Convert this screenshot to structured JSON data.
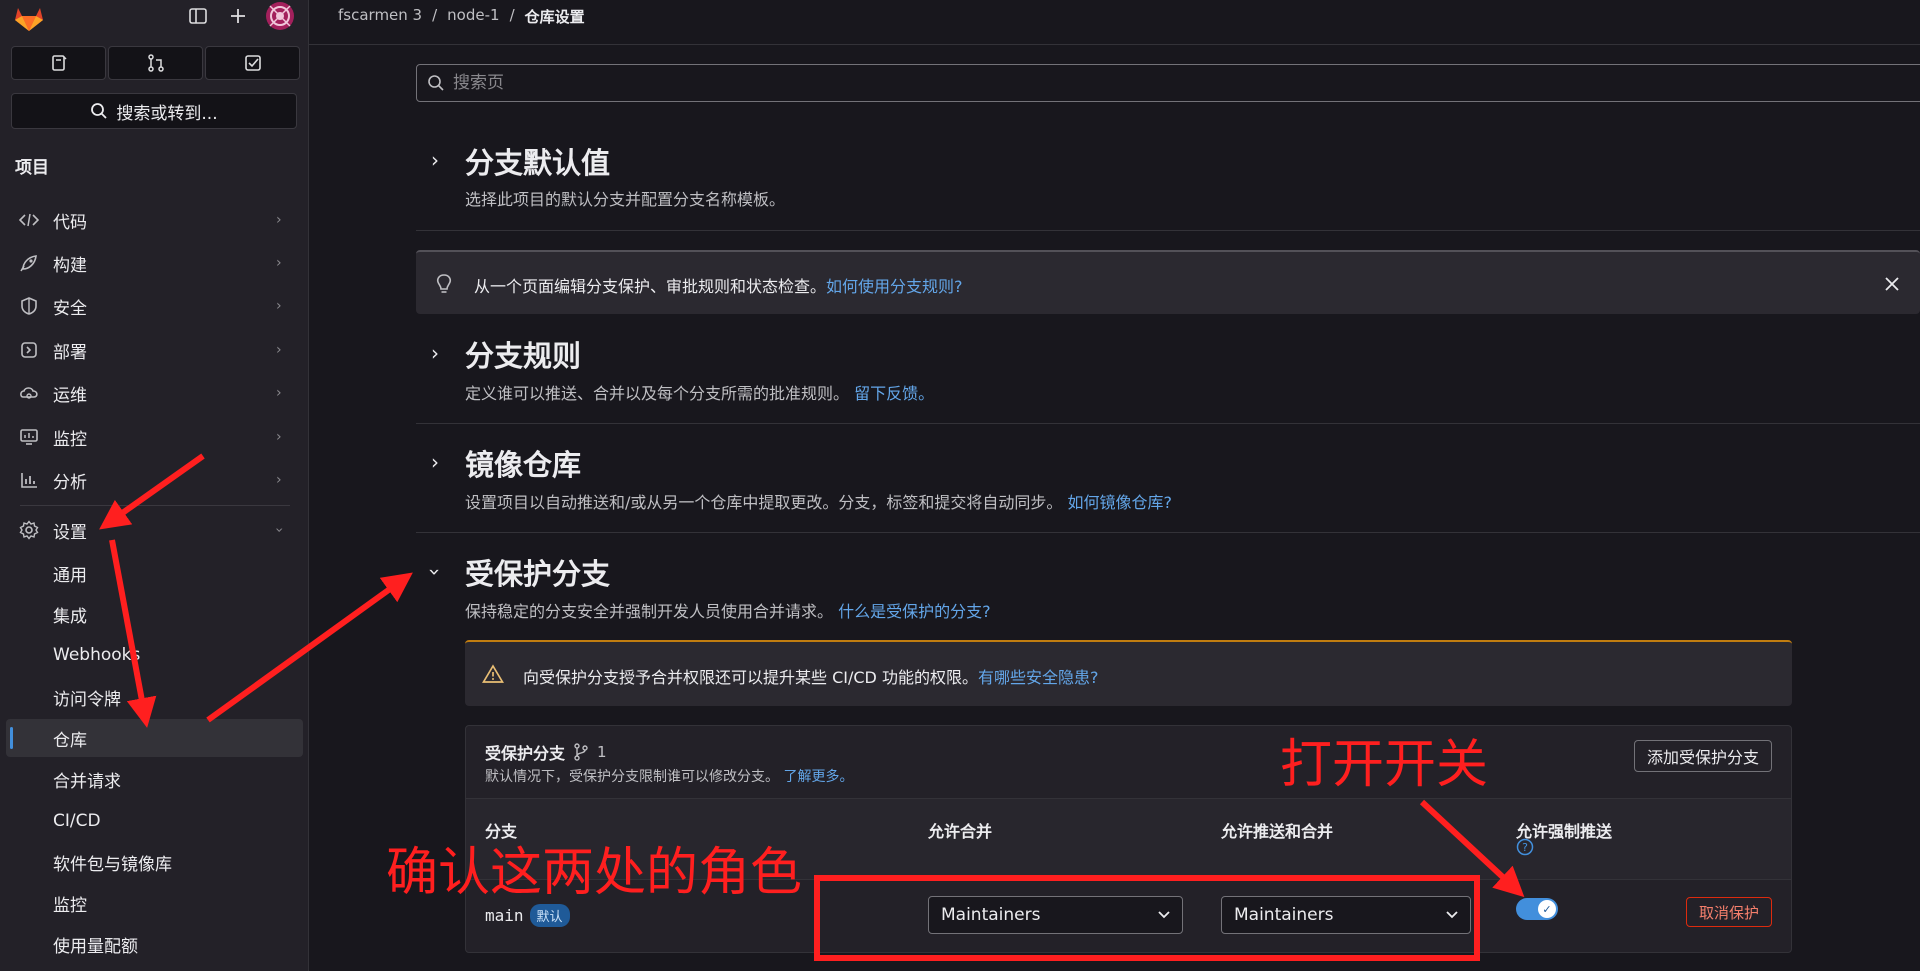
{
  "sidebar": {
    "top_buttons": [
      {
        "icon": "issues-icon"
      },
      {
        "icon": "merge-request-icon"
      },
      {
        "icon": "todo-icon"
      }
    ],
    "search_label": "搜索或转到...",
    "section_title": "项目",
    "nav": [
      {
        "label": "代码",
        "icon": "code-icon"
      },
      {
        "label": "构建",
        "icon": "rocket-icon"
      },
      {
        "label": "安全",
        "icon": "shield-icon"
      },
      {
        "label": "部署",
        "icon": "deploy-icon"
      },
      {
        "label": "运维",
        "icon": "operate-icon"
      },
      {
        "label": "监控",
        "icon": "monitor-icon"
      },
      {
        "label": "分析",
        "icon": "chart-icon"
      },
      {
        "label": "设置",
        "icon": "gear-icon"
      }
    ],
    "settings_sub": [
      {
        "label": "通用"
      },
      {
        "label": "集成"
      },
      {
        "label": "Webhooks"
      },
      {
        "label": "访问令牌"
      },
      {
        "label": "仓库"
      },
      {
        "label": "合并请求"
      },
      {
        "label": "CI/CD"
      },
      {
        "label": "软件包与镜像库"
      },
      {
        "label": "监控"
      },
      {
        "label": "使用量配额"
      }
    ]
  },
  "breadcrumb": {
    "items": [
      "fscarmen 3",
      "node-1"
    ],
    "current": "仓库设置",
    "sep": "/"
  },
  "page_search": {
    "placeholder": "搜索页"
  },
  "sections": {
    "branch_defaults": {
      "title": "分支默认值",
      "desc": "选择此项目的默认分支并配置分支名称模板。"
    },
    "info_alert": {
      "text": "从一个页面编辑分支保护、审批规则和状态检查。",
      "link": "如何使用分支规则?"
    },
    "branch_rules": {
      "title": "分支规则",
      "desc": "定义谁可以推送、合并以及每个分支所需的批准规则。",
      "link": "留下反馈。"
    },
    "mirror": {
      "title": "镜像仓库",
      "desc": "设置项目以自动推送和/或从另一个仓库中提取更改。分支，标签和提交将自动同步。",
      "link": "如何镜像仓库?"
    },
    "protected": {
      "title": "受保护分支",
      "desc": "保持稳定的分支安全并强制开发人员使用合并请求。",
      "link": "什么是受保护的分支?"
    },
    "warning": {
      "text": "向受保护分支授予合并权限还可以提升某些 CI/CD 功能的权限。",
      "link": "有哪些安全隐患?"
    }
  },
  "panel": {
    "title": "受保护分支",
    "count": "1",
    "desc": "默认情况下，受保护分支限制谁可以修改分支。",
    "desc_link": "了解更多。",
    "add_button": "添加受保护分支",
    "columns": {
      "branch": "分支",
      "merge": "允许合并",
      "push": "允许推送和合并",
      "force": "允许强制推送"
    },
    "row": {
      "branch": "main",
      "default_badge": "默认",
      "merge_role": "Maintainers",
      "push_role": "Maintainers",
      "force_push_enabled": true,
      "unprotect": "取消保护"
    }
  },
  "annotations": {
    "toggle_note": "打开开关",
    "roles_note": "确认这两处的角色",
    "color": "#ff1f1f"
  }
}
